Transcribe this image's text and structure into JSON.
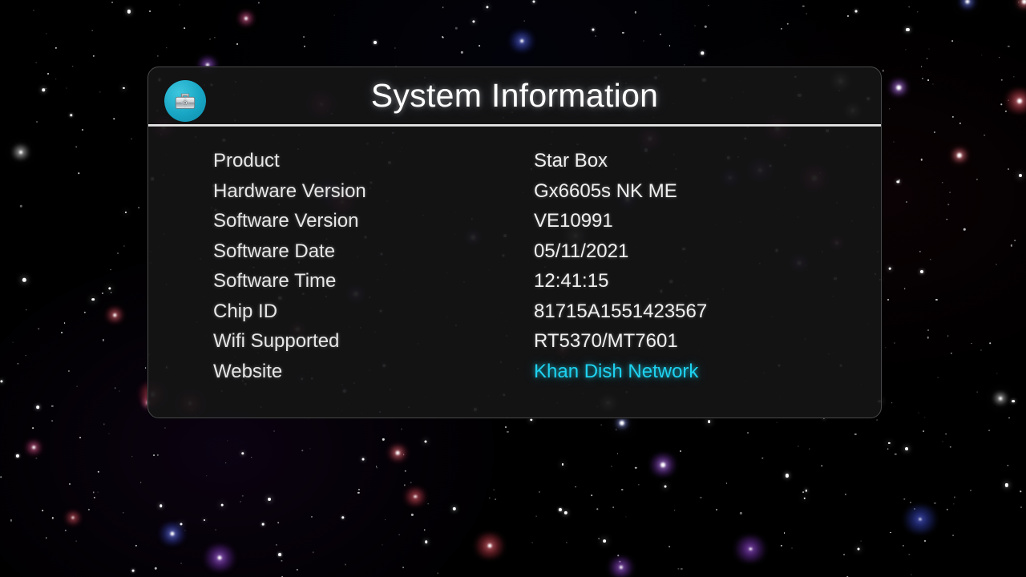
{
  "dialog": {
    "title": "System Information",
    "icon": "toolbox-icon",
    "accent_color": "#18a6c4",
    "link_color": "#1ed2ef",
    "panel_bg": "#141415",
    "border_color": "#4a4a4c"
  },
  "info": {
    "rows": [
      {
        "label": "Product",
        "value": "Star Box",
        "is_link": false
      },
      {
        "label": "Hardware Version",
        "value": "Gx6605s NK ME",
        "is_link": false
      },
      {
        "label": "Software Version",
        "value": "VE10991",
        "is_link": false
      },
      {
        "label": "Software Date",
        "value": "05/11/2021",
        "is_link": false
      },
      {
        "label": "Software Time",
        "value": "12:41:15",
        "is_link": false
      },
      {
        "label": "Chip ID",
        "value": "81715A1551423567",
        "is_link": false
      },
      {
        "label": "Wifi Supported",
        "value": "RT5370/MT7601",
        "is_link": false
      },
      {
        "label": "Website",
        "value": "Khan Dish Network",
        "is_link": true
      }
    ]
  },
  "background": {
    "name": "starfield-background",
    "base_color": "#000000"
  }
}
